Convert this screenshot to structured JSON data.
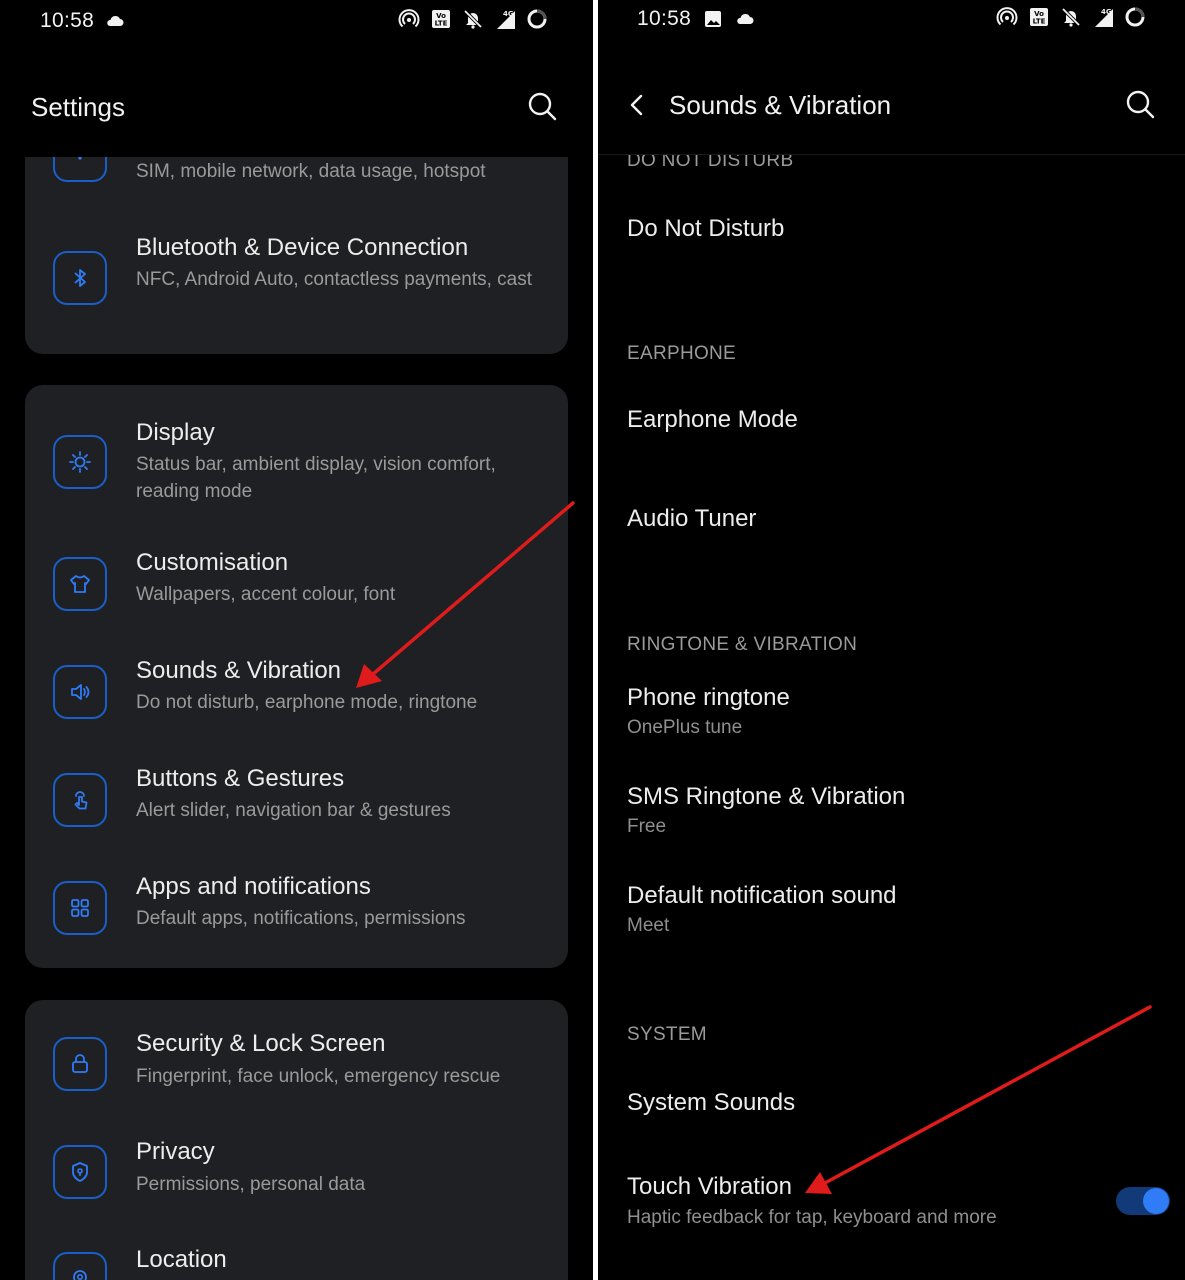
{
  "left": {
    "status": {
      "time": "10:58",
      "icons": [
        "cloud-icon",
        "hotspot-icon",
        "volte-icon",
        "bell-off-icon",
        "signal-4g-icon",
        "battery-icon"
      ]
    },
    "header": {
      "title": "Settings",
      "search_icon": "search-icon"
    },
    "cards": [
      {
        "rows": [
          {
            "icon": "sim-icon",
            "title": "",
            "subtitle": "SIM, mobile network, data usage, hotspot"
          },
          {
            "icon": "bluetooth-icon",
            "title": "Bluetooth & Device Connection",
            "subtitle": "NFC, Android Auto, contactless payments, cast"
          }
        ]
      },
      {
        "rows": [
          {
            "icon": "brightness-icon",
            "title": "Display",
            "subtitle": "Status bar, ambient display, vision comfort, reading mode"
          },
          {
            "icon": "tshirt-icon",
            "title": "Customisation",
            "subtitle": "Wallpapers, accent colour, font"
          },
          {
            "icon": "speaker-icon",
            "title": "Sounds & Vibration",
            "subtitle": "Do not disturb, earphone mode, ringtone"
          },
          {
            "icon": "touch-icon",
            "title": "Buttons & Gestures",
            "subtitle": "Alert slider, navigation bar & gestures"
          },
          {
            "icon": "apps-grid-icon",
            "title": "Apps and notifications",
            "subtitle": "Default apps, notifications, permissions"
          }
        ]
      },
      {
        "rows": [
          {
            "icon": "lock-icon",
            "title": "Security & Lock Screen",
            "subtitle": "Fingerprint, face unlock, emergency rescue"
          },
          {
            "icon": "shield-icon",
            "title": "Privacy",
            "subtitle": "Permissions, personal data"
          },
          {
            "icon": "location-icon",
            "title": "Location",
            "subtitle": ""
          }
        ]
      }
    ]
  },
  "right": {
    "status": {
      "time": "10:58",
      "icons": [
        "image-icon",
        "cloud-icon",
        "hotspot-icon",
        "volte-icon",
        "bell-off-icon",
        "signal-4g-icon",
        "battery-icon"
      ]
    },
    "header": {
      "title": "Sounds & Vibration",
      "back_icon": "back-arrow-icon",
      "search_icon": "search-icon"
    },
    "sections": {
      "dnd": {
        "heading": "DO NOT DISTURB",
        "items": [
          {
            "title": "Do Not Disturb",
            "subtitle": ""
          }
        ]
      },
      "earphone": {
        "heading": "EARPHONE",
        "items": [
          {
            "title": "Earphone Mode",
            "subtitle": ""
          },
          {
            "title": "Audio Tuner",
            "subtitle": ""
          }
        ]
      },
      "ringtone": {
        "heading": "RINGTONE & VIBRATION",
        "items": [
          {
            "title": "Phone ringtone",
            "subtitle": "OnePlus tune"
          },
          {
            "title": "SMS Ringtone & Vibration",
            "subtitle": "Free"
          },
          {
            "title": "Default notification sound",
            "subtitle": "Meet"
          }
        ]
      },
      "system": {
        "heading": "SYSTEM",
        "items": [
          {
            "title": "System Sounds",
            "subtitle": ""
          },
          {
            "title": "Touch Vibration",
            "subtitle": "Haptic feedback for tap, keyboard and more",
            "toggle_on": true
          }
        ]
      }
    }
  },
  "colors": {
    "background": "#000000",
    "card": "#1f2023",
    "accent": "#2f7cf6",
    "icon_outline": "#1a5fc7",
    "annotation_arrow": "#e01b1b"
  }
}
